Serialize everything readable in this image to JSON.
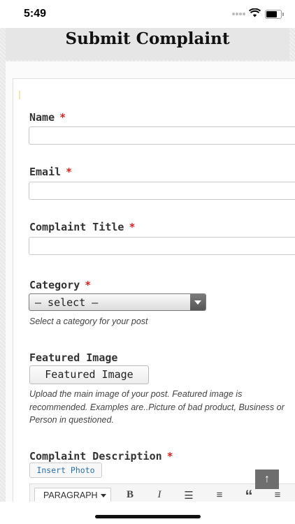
{
  "status_bar": {
    "time": "5:49"
  },
  "page": {
    "title": "Submit Complaint"
  },
  "form": {
    "name": {
      "label": "Name",
      "required_mark": "*",
      "value": ""
    },
    "email": {
      "label": "Email",
      "required_mark": "*",
      "value": ""
    },
    "complaint_title": {
      "label": "Complaint Title",
      "required_mark": "*",
      "value": ""
    },
    "category": {
      "label": "Category",
      "required_mark": "*",
      "selected": "— select —",
      "help": "Select a category for your post"
    },
    "featured_image": {
      "label": "Featured Image",
      "button": "Featured Image",
      "help": "Upload the main image of your post. Featured image is recommended. Examples are..Picture of bad product, Business or Person in questioned."
    },
    "complaint_description": {
      "label": "Complaint Description",
      "required_mark": "*",
      "insert_photo": "Insert Photo",
      "toolbar": {
        "format": "PARAGRAPH",
        "bold": "B",
        "italic": "I",
        "bullet_list": "☰",
        "numbered_list": "≡",
        "quote": "“",
        "align": "≡"
      }
    }
  },
  "scroll_top": {
    "icon": "arrow-up-icon",
    "glyph": "↑"
  }
}
